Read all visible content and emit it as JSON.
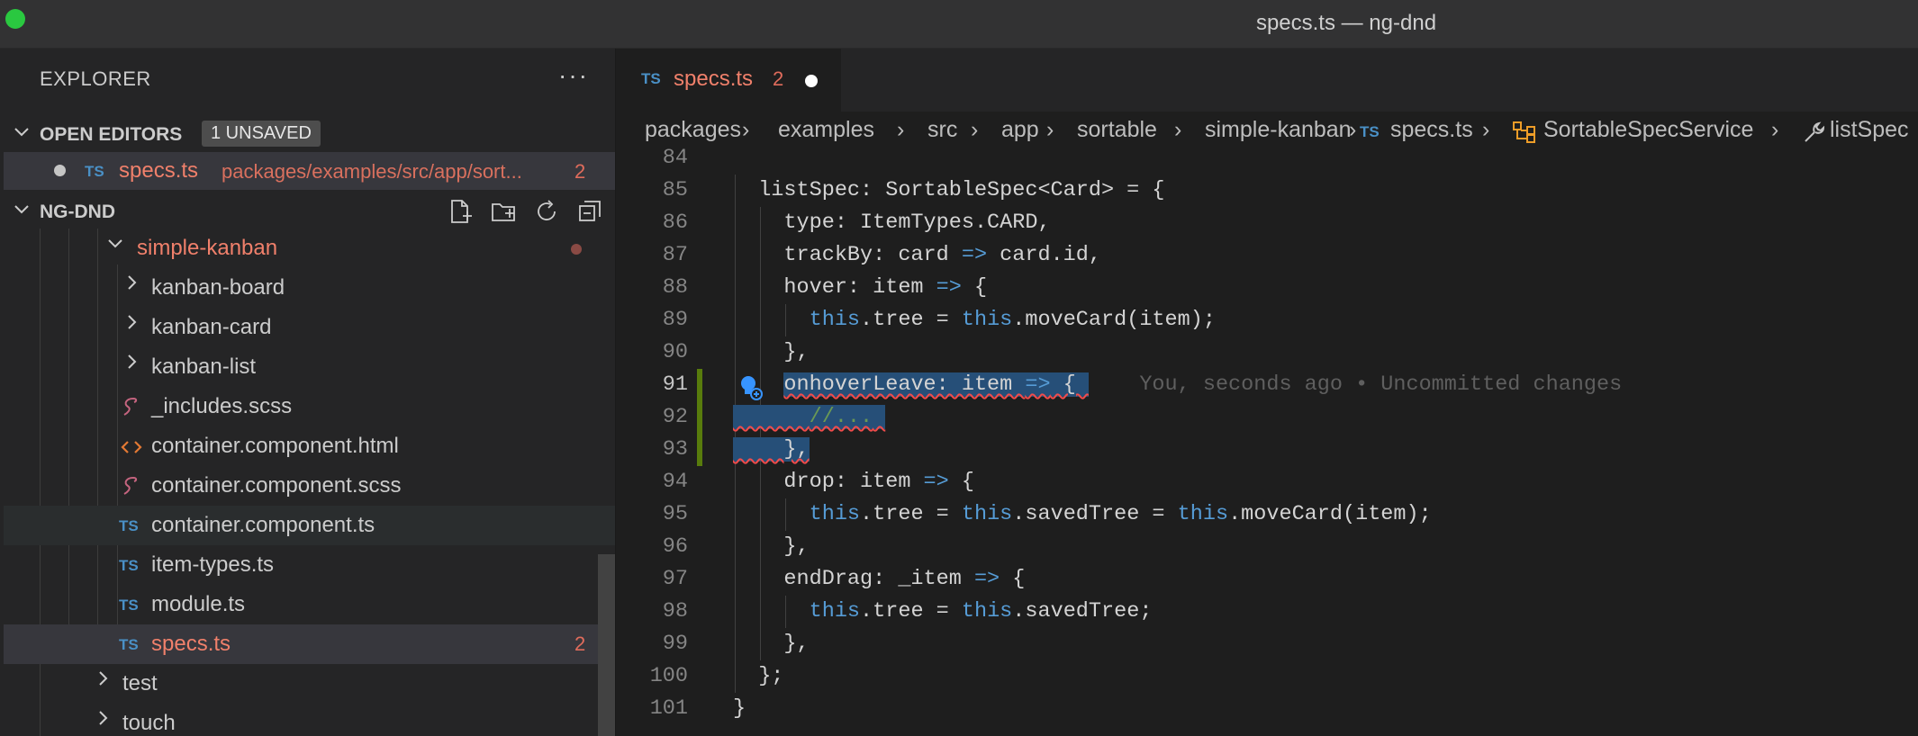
{
  "window": {
    "title": "specs.ts — ng-dnd"
  },
  "sidebar": {
    "header": "EXPLORER",
    "more": "···",
    "open_editors": {
      "label": "OPEN EDITORS",
      "badge": "1 UNSAVED",
      "item": {
        "icon": "TS",
        "name": "specs.ts",
        "path": "packages/examples/src/app/sort...",
        "problems": "2"
      }
    },
    "project": {
      "label": "NG-DND",
      "tools": [
        "new-file-icon",
        "new-folder-icon",
        "refresh-icon",
        "collapse-all-icon"
      ]
    },
    "tree": [
      {
        "name": "simple-kanban",
        "kind": "folder-open",
        "modified": true
      },
      {
        "name": "kanban-board",
        "kind": "folder"
      },
      {
        "name": "kanban-card",
        "kind": "folder"
      },
      {
        "name": "kanban-list",
        "kind": "folder"
      },
      {
        "name": "_includes.scss",
        "kind": "scss"
      },
      {
        "name": "container.component.html",
        "kind": "html"
      },
      {
        "name": "container.component.scss",
        "kind": "scss"
      },
      {
        "name": "container.component.ts",
        "kind": "ts",
        "icon": "TS"
      },
      {
        "name": "item-types.ts",
        "kind": "ts",
        "icon": "TS"
      },
      {
        "name": "module.ts",
        "kind": "ts",
        "icon": "TS"
      },
      {
        "name": "specs.ts",
        "kind": "ts",
        "icon": "TS",
        "problems": "2",
        "selected": true
      },
      {
        "name": "test",
        "kind": "folder"
      },
      {
        "name": "touch",
        "kind": "folder"
      }
    ]
  },
  "editor": {
    "tab": {
      "icon": "TS",
      "name": "specs.ts",
      "problems": "2",
      "dirty": true
    },
    "breadcrumb": {
      "parts": [
        "packages",
        "examples",
        "src",
        "app",
        "sortable",
        "simple-kanban"
      ],
      "file_icon": "TS",
      "file": "specs.ts",
      "class": "SortableSpecService",
      "member": "listSpec"
    },
    "blame": "You, seconds ago • Uncommitted changes",
    "line_numbers": [
      "84",
      "85",
      "86",
      "87",
      "88",
      "89",
      "90",
      "91",
      "92",
      "93",
      "94",
      "95",
      "96",
      "97",
      "98",
      "99",
      "100",
      "101"
    ]
  },
  "colors": {
    "accent_error": "#f0806b",
    "selection": "#264f78",
    "git_modified": "#587c0c",
    "keyword": "#569cd6",
    "comment": "#6a9955"
  }
}
